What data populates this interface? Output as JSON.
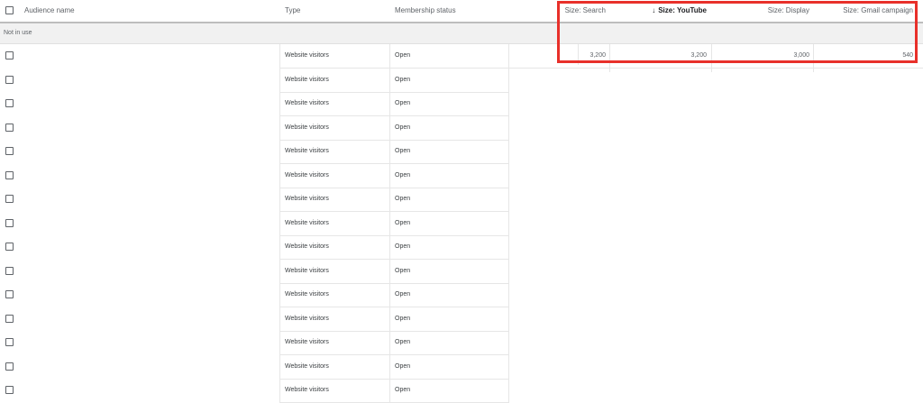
{
  "header": {
    "audience_name": "Audience name",
    "type": "Type",
    "membership_status": "Membership status",
    "size_search": "Size: Search",
    "size_youtube": "Size: YouTube",
    "size_display": "Size: Display",
    "size_gmail": "Size: Gmail campaign",
    "sort_icon": "arrow-down-icon"
  },
  "group": {
    "label": "Not in use"
  },
  "rows": [
    {
      "type": "Website visitors",
      "status": "Open",
      "search": "3,200",
      "youtube": "3,200",
      "display": "3,000",
      "gmail": "540"
    },
    {
      "type": "Website visitors",
      "status": "Open"
    },
    {
      "type": "Website visitors",
      "status": "Open"
    },
    {
      "type": "Website visitors",
      "status": "Open"
    },
    {
      "type": "Website visitors",
      "status": "Open"
    },
    {
      "type": "Website visitors",
      "status": "Open"
    },
    {
      "type": "Website visitors",
      "status": "Open"
    },
    {
      "type": "Website visitors",
      "status": "Open"
    },
    {
      "type": "Website visitors",
      "status": "Open"
    },
    {
      "type": "Website visitors",
      "status": "Open"
    },
    {
      "type": "Website visitors",
      "status": "Open"
    },
    {
      "type": "Website visitors",
      "status": "Open"
    },
    {
      "type": "Website visitors",
      "status": "Open"
    },
    {
      "type": "Website visitors",
      "status": "Open"
    },
    {
      "type": "Website visitors",
      "status": "Open"
    }
  ],
  "colors": {
    "highlight": "#e8302a",
    "group_bg": "#f1f1f1"
  }
}
